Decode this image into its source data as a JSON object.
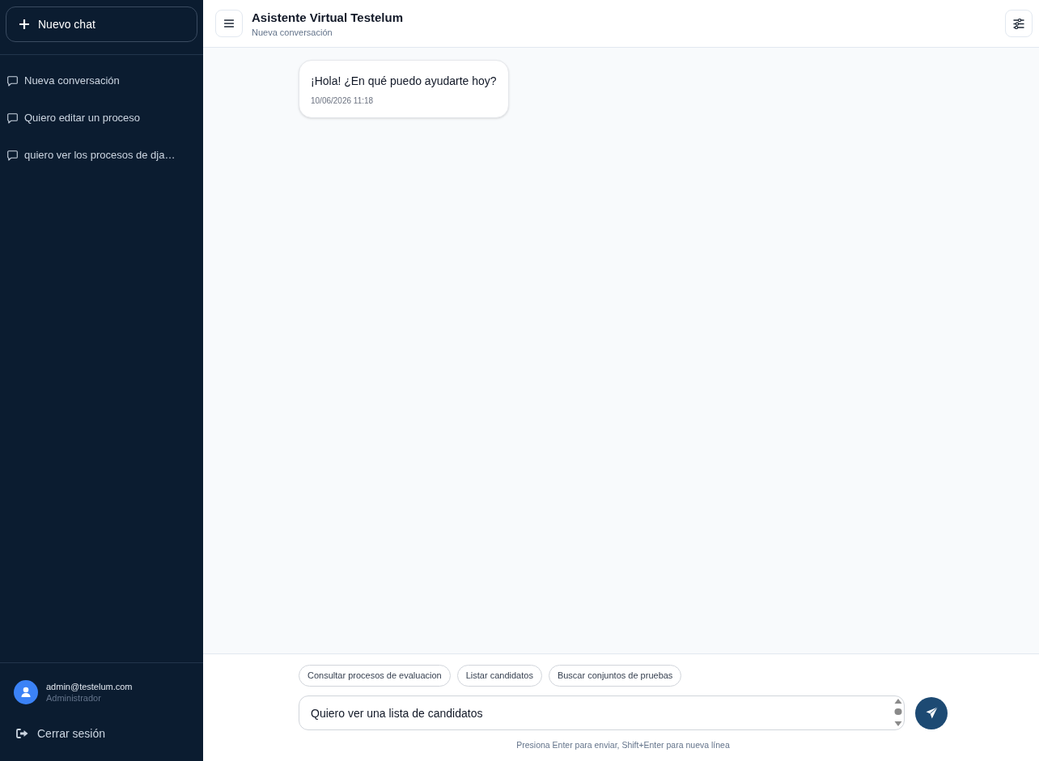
{
  "sidebar": {
    "new_chat_button": {
      "label": "Nuevo chat"
    },
    "conversations": [
      {
        "title": "Nueva conversación",
        "selected": false
      },
      {
        "title": "Quiero editar un proceso",
        "selected": false
      },
      {
        "title": "quiero ver los procesos de dja…",
        "selected": false
      }
    ],
    "user": {
      "email": "admin@testelum.com",
      "role": "Administrador"
    },
    "logout_button": {
      "label": "Cerrar sesión"
    }
  },
  "header": {
    "title": "Asistente Virtual Testelum",
    "subtitle": "Nueva conversación"
  },
  "messages": [
    {
      "kind": "assistant",
      "text": "¡Hola! ¿En qué puedo ayudarte hoy?",
      "time": "10/06/2026 11:18"
    }
  ],
  "suggestions": [
    "Consultar procesos de evaluacion",
    "Listar candidatos",
    "Buscar conjuntos de pruebas"
  ],
  "composer": {
    "value": "Quiero ver una lista de candidatos"
  },
  "hint": "Presiona Enter para enviar, Shift+Enter para nueva línea"
}
